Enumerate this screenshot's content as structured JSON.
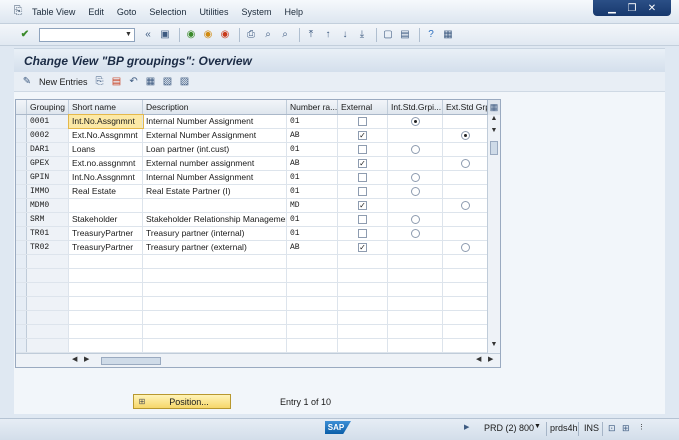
{
  "menu": {
    "items": [
      "Table View",
      "Edit",
      "Goto",
      "Selection",
      "Utilities",
      "System",
      "Help"
    ],
    "underline": [
      "T",
      "E",
      "G",
      "S",
      "U",
      "y",
      "H"
    ]
  },
  "window_controls": {
    "minimize": "▁",
    "restore": "❐",
    "close": "✕"
  },
  "toolbar": {
    "command_field_value": ""
  },
  "title": "Change View \"BP groupings\": Overview",
  "app_toolbar": {
    "new_entries": "New Entries"
  },
  "table": {
    "columns": [
      "Grouping",
      "Short name",
      "Description",
      "Number ra...",
      "External",
      "Int.Std.Grpi...",
      "Ext.Std Grp"
    ],
    "rows": [
      {
        "grouping": "0001",
        "short": "Int.No.Assgnmnt",
        "desc": "Internal Number Assignment",
        "range": "01",
        "external": false,
        "int_std": "selected",
        "ext_std": "none"
      },
      {
        "grouping": "0002",
        "short": "Ext.No.Assgnmnt",
        "desc": "External Number Assignment",
        "range": "AB",
        "external": true,
        "int_std": "none",
        "ext_std": "selected"
      },
      {
        "grouping": "DAR1",
        "short": "Loans",
        "desc": "Loan partner (int.cust)",
        "range": "01",
        "external": false,
        "int_std": "unselected",
        "ext_std": "none"
      },
      {
        "grouping": "GPEX",
        "short": "Ext.no.assgnmnt",
        "desc": "External number assignment",
        "range": "AB",
        "external": true,
        "int_std": "none",
        "ext_std": "unselected"
      },
      {
        "grouping": "GPIN",
        "short": "Int.No.Assgnmnt",
        "desc": "Internal Number Assignment",
        "range": "01",
        "external": false,
        "int_std": "unselected",
        "ext_std": "none"
      },
      {
        "grouping": "IMMO",
        "short": "Real Estate",
        "desc": "Real Estate Partner (I)",
        "range": "01",
        "external": false,
        "int_std": "unselected",
        "ext_std": "none"
      },
      {
        "grouping": "MDM0",
        "short": "",
        "desc": "",
        "range": "MD",
        "external": true,
        "int_std": "none",
        "ext_std": "unselected"
      },
      {
        "grouping": "SRM",
        "short": "Stakeholder",
        "desc": "Stakeholder Relationship Management",
        "range": "01",
        "external": false,
        "int_std": "unselected",
        "ext_std": "none"
      },
      {
        "grouping": "TR01",
        "short": "TreasuryPartner",
        "desc": "Treasury partner (internal)",
        "range": "01",
        "external": false,
        "int_std": "unselected",
        "ext_std": "none"
      },
      {
        "grouping": "TR02",
        "short": "TreasuryPartner",
        "desc": "Treasury partner (external)",
        "range": "AB",
        "external": true,
        "int_std": "none",
        "ext_std": "unselected"
      }
    ],
    "empty_rows": 8
  },
  "position_button": "Position...",
  "entry_info": "Entry 1 of 10",
  "status": {
    "logo": "SAP",
    "system": "PRD (2) 800",
    "server": "prds4h",
    "mode": "INS"
  },
  "colors": {
    "accent": "#17386d",
    "focus": "#fce9a6",
    "position_button": "#f6d76a"
  }
}
